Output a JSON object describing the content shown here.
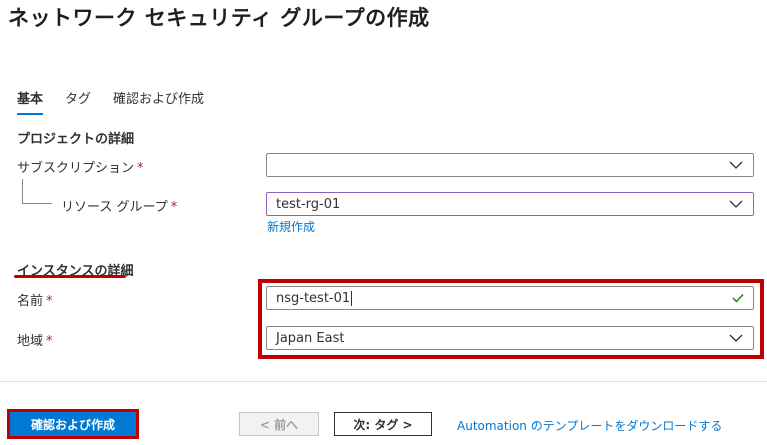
{
  "header": {
    "title": "ネットワーク セキュリティ グループの作成",
    "more": "···"
  },
  "tabs": [
    {
      "label": "基本",
      "active": true
    },
    {
      "label": "タグ",
      "active": false
    },
    {
      "label": "確認および作成",
      "active": false
    }
  ],
  "project": {
    "heading": "プロジェクトの詳細",
    "subscription_label": "サブスクリプション",
    "subscription_value": "",
    "resource_group_label": "リソース グループ",
    "resource_group_value": "test-rg-01",
    "create_new_link": "新規作成"
  },
  "instance": {
    "heading": "インスタンスの詳細",
    "name_label": "名前",
    "name_value": "nsg-test-01",
    "region_label": "地域",
    "region_value": "Japan East"
  },
  "required_mark": "*",
  "footer": {
    "review_create": "確認および作成",
    "prev": "< 前へ",
    "next": "次: タグ >",
    "download_link": "Automation のテンプレートをダウンロードする"
  },
  "colors": {
    "accent": "#0078d4",
    "highlight": "#c00000",
    "required": "#a4262c",
    "valid": "#107c10"
  }
}
